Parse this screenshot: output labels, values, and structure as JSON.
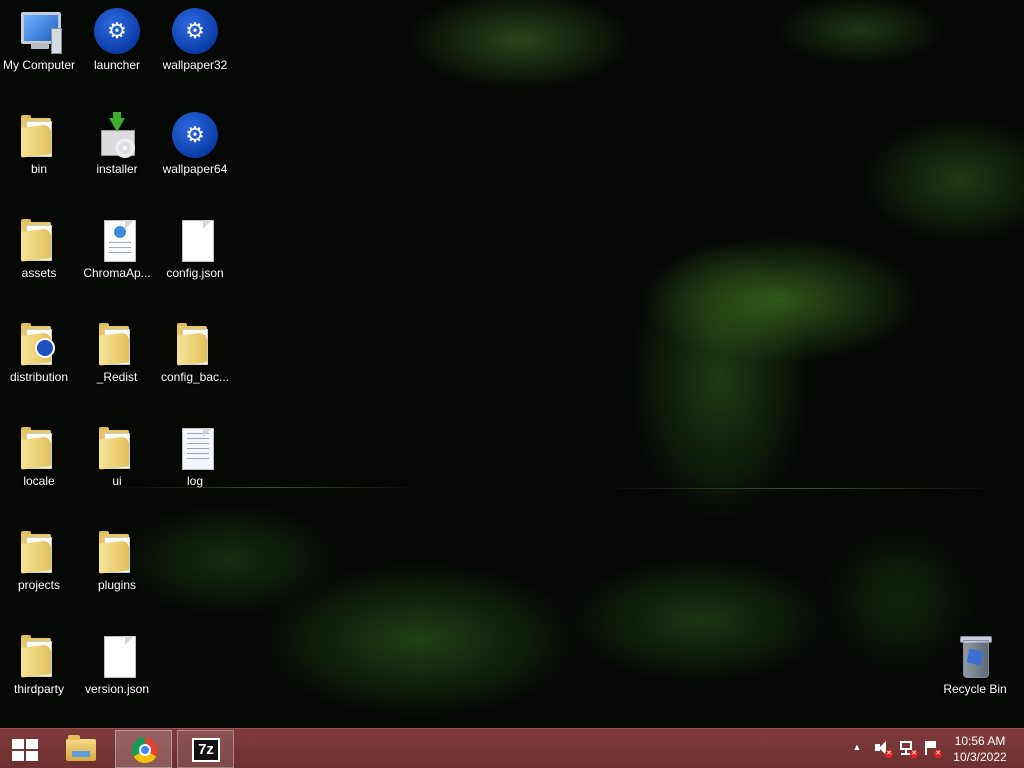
{
  "desktop": {
    "icons": [
      {
        "label": "My Computer",
        "type": "computer"
      },
      {
        "label": "launcher",
        "type": "app"
      },
      {
        "label": "wallpaper32",
        "type": "app"
      },
      {
        "label": "bin",
        "type": "folder"
      },
      {
        "label": "installer",
        "type": "installer"
      },
      {
        "label": "wallpaper64",
        "type": "app"
      },
      {
        "label": "assets",
        "type": "folder"
      },
      {
        "label": "ChromaAp...",
        "type": "html-file"
      },
      {
        "label": "config.json",
        "type": "file"
      },
      {
        "label": "distribution",
        "type": "folder"
      },
      {
        "label": "_Redist",
        "type": "folder"
      },
      {
        "label": "config_bac...",
        "type": "folder"
      },
      {
        "label": "locale",
        "type": "folder"
      },
      {
        "label": "ui",
        "type": "folder"
      },
      {
        "label": "log",
        "type": "text-file"
      },
      {
        "label": "projects",
        "type": "folder"
      },
      {
        "label": "plugins",
        "type": "folder"
      },
      {
        "label": "thirdparty",
        "type": "folder"
      },
      {
        "label": "version.json",
        "type": "file"
      },
      {
        "label": "Recycle Bin",
        "type": "recycle-bin"
      }
    ]
  },
  "taskbar": {
    "start_icon": "windows-logo-icon",
    "pinned": [
      {
        "name": "file-explorer",
        "icon": "folder-icon",
        "active": false
      },
      {
        "name": "chrome",
        "icon": "chrome-icon",
        "active": true
      },
      {
        "name": "7-zip",
        "icon": "sevenzip-icon",
        "label": "7z",
        "active": true
      }
    ],
    "tray": {
      "icons": [
        "show-hidden-icons-arrow",
        "volume-muted-icon",
        "network-error-icon",
        "action-center-flag-icon"
      ],
      "time": "10:56 AM",
      "date": "10/3/2022"
    }
  },
  "colors": {
    "taskbar": "#7a3838",
    "wallpaper_accent": "#3f7a25",
    "folder": "#e8c766",
    "app_icon": "#0b3da8"
  }
}
